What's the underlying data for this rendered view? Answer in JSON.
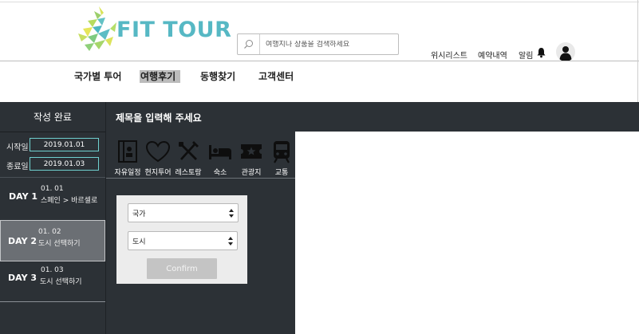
{
  "brand": {
    "name": "FIT TOUR"
  },
  "search": {
    "placeholder": "여행지나 상품을 검색하세요"
  },
  "top_links": {
    "wishlist": "위시리스트",
    "reservations": "예약내역",
    "alerts": "알림"
  },
  "nav": [
    "국가별 투어",
    "여행후기",
    "동행찾기",
    "고객센터"
  ],
  "nav_active": "여행후기",
  "sidebar": {
    "done_label": "작성 완료",
    "start_label": "시작일",
    "start_value": "2019.01.01",
    "end_label": "종료일",
    "end_value": "2019.01.03",
    "days": [
      {
        "label": "DAY 1",
        "date": "01. 01",
        "place": "스페인 > 바르셀로"
      },
      {
        "label": "DAY 2",
        "date": "01. 02",
        "place": "도시 선택하기"
      },
      {
        "label": "DAY 3",
        "date": "01. 03",
        "place": "도시 선택하기"
      }
    ],
    "selected_day": "DAY 2"
  },
  "editor": {
    "title_placeholder": "제목을 입력해 주세요"
  },
  "categories": [
    {
      "label": "자유일정",
      "icon": "notebook-icon"
    },
    {
      "label": "현지투어",
      "icon": "heart-icon"
    },
    {
      "label": "레스토랑",
      "icon": "fork-knife-icon"
    },
    {
      "label": "숙소",
      "icon": "bed-icon"
    },
    {
      "label": "관광지",
      "icon": "ticket-icon"
    },
    {
      "label": "교통",
      "icon": "train-icon"
    }
  ],
  "location_picker": {
    "country_value": "국가",
    "city_value": "도시",
    "confirm_label": "Confirm"
  },
  "colors": {
    "brand": "#56b8c4",
    "dark_panel": "#2c3136",
    "date_border": "#6fd0cf"
  }
}
